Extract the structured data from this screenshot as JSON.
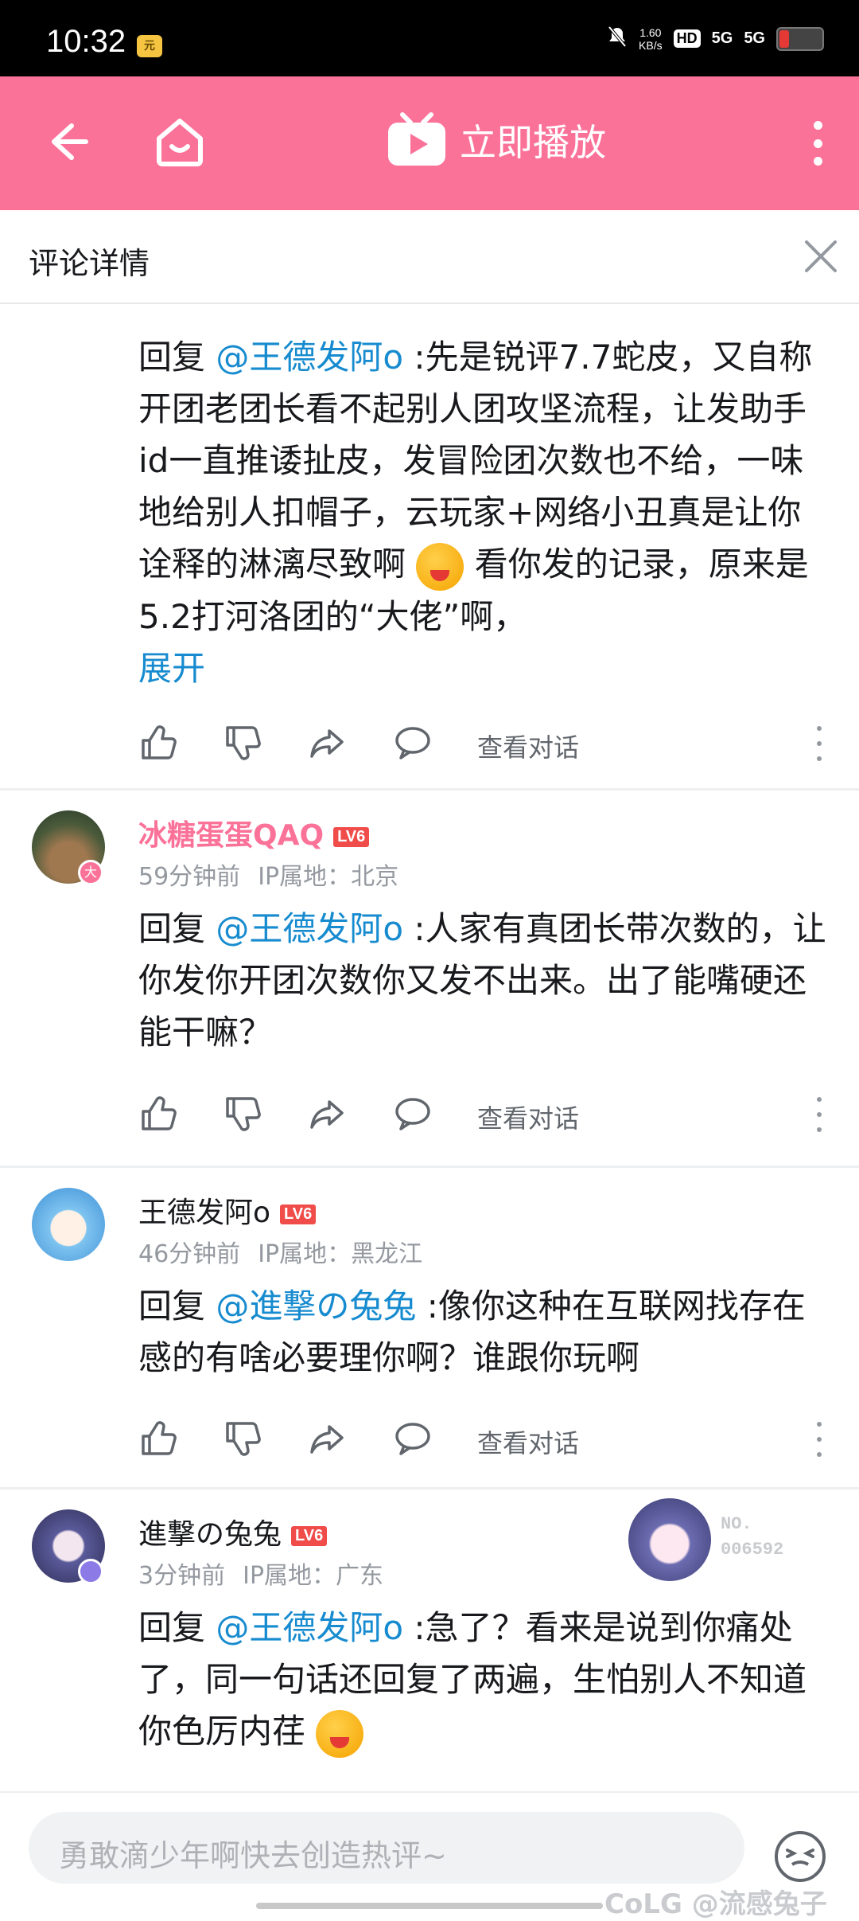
{
  "status": {
    "time": "10:32",
    "speed_top": "1.60",
    "speed_unit": "KB/s",
    "hd": "HD",
    "net1": "5G",
    "net2": "5G"
  },
  "topbar": {
    "play_label": "立即播放"
  },
  "section": {
    "title": "评论详情"
  },
  "comments": [
    {
      "reply_prefix": "回复 ",
      "mention": "@王德发阿o",
      "text1": " :先是锐评7.7蛇皮，又自称开团老团长看不起别人团攻坚流程，让发助手id一直推诿扯皮，发冒险团次数也不给，一味地给别人扣帽子，云玩家+网络小丑真是让你诠释的淋漓尽致啊",
      "text2": "看你发的记录，原来是5.2打河洛团的“大佬”啊，",
      "expand": "展开",
      "view_conv": "查看对话"
    },
    {
      "name": "冰糖蛋蛋QAQ",
      "level": "LV6",
      "badge": "大",
      "time": "59分钟前",
      "ip": "IP属地：北京",
      "reply_prefix": "回复 ",
      "mention": "@王德发阿o",
      "text1": " :人家有真团长带次数的，让你发你开团次数你又发不出来。出了能嘴硬还能干嘛？",
      "view_conv": "查看对话"
    },
    {
      "name": "王德发阿o",
      "level": "LV6",
      "time": "46分钟前",
      "ip": "IP属地：黑龙江",
      "reply_prefix": "回复 ",
      "mention": "@進撃の兔兔",
      "text1": " :像你这种在互联网找存在感的有啥必要理你啊？谁跟你玩啊",
      "view_conv": "查看对话"
    },
    {
      "name": "進撃の兔兔",
      "level": "LV6",
      "time": "3分钟前",
      "ip": "IP属地：广东",
      "card_no_label": "NO.",
      "card_no": "006592",
      "reply_prefix": "回复 ",
      "mention": "@王德发阿o",
      "text1": " :急了？看来是说到你痛处了，同一句话还回复了两遍，生怕别人不知道你色厉内荏"
    }
  ],
  "bottom": {
    "placeholder": "勇敢滴少年啊快去创造热评~",
    "watermark": "CoLG @流感兔子"
  },
  "colors": {
    "brand_pink": "#fb7299",
    "link_blue": "#178bcf",
    "level_red": "#f04c49"
  }
}
